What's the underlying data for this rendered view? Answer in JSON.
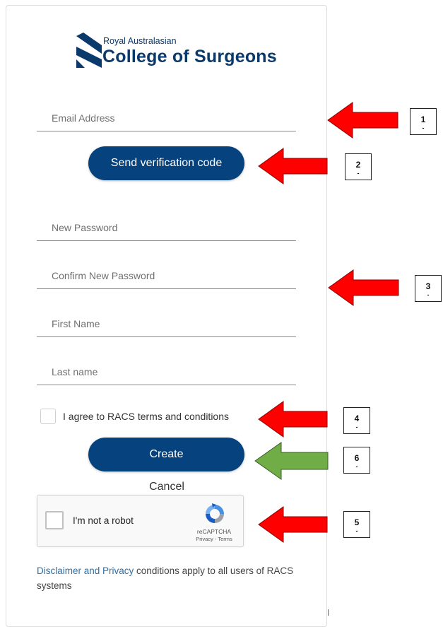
{
  "logo": {
    "line1": "Royal Australasian",
    "line2": "College of Surgeons"
  },
  "form": {
    "email_placeholder": "Email Address",
    "send_code_label": "Send verification code",
    "new_password_placeholder": "New Password",
    "confirm_password_placeholder": "Confirm New Password",
    "first_name_placeholder": "First Name",
    "last_name_placeholder": "Last name",
    "terms_label": "I agree to RACS terms and conditions",
    "create_label": "Create",
    "cancel_label": "Cancel"
  },
  "recaptcha": {
    "label": "I'm not a robot",
    "brand": "reCAPTCHA",
    "links": "Privacy - Terms"
  },
  "footer": {
    "link_text": "Disclaimer and Privacy",
    "rest_text": " conditions apply to all users of RACS systems"
  },
  "annotations": {
    "colors": {
      "red": "#ff0000",
      "green": "#70ad47"
    },
    "items": [
      {
        "number": "1",
        "mark": "-",
        "color": "red"
      },
      {
        "number": "2",
        "mark": "-",
        "color": "red"
      },
      {
        "number": "3",
        "mark": "-",
        "color": "red"
      },
      {
        "number": "4",
        "mark": "-",
        "color": "red"
      },
      {
        "number": "6",
        "mark": "-",
        "color": "green"
      },
      {
        "number": "5",
        "mark": "-",
        "color": "red"
      }
    ]
  },
  "theme": {
    "brand": "#06427d",
    "link": "#2f6ea4"
  }
}
